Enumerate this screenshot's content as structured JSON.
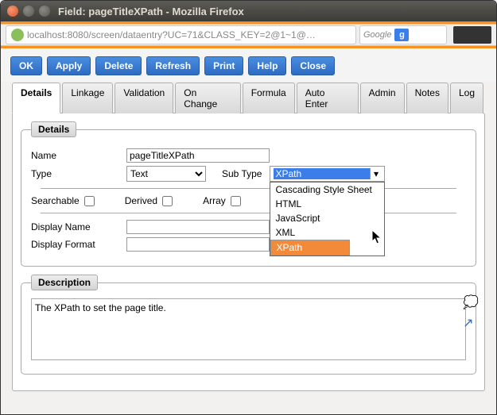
{
  "window": {
    "title": "Field: pageTitleXPath - Mozilla Firefox"
  },
  "url": "localhost:8080/screen/dataentry?UC=71&CLASS_KEY=2@1~1@…",
  "search": {
    "placeholder": "Google",
    "g": "g"
  },
  "toolbar": {
    "ok": "OK",
    "apply": "Apply",
    "delete": "Delete",
    "refresh": "Refresh",
    "print": "Print",
    "help": "Help",
    "close": "Close"
  },
  "tabs": {
    "details": "Details",
    "linkage": "Linkage",
    "validation": "Validation",
    "onchange": "On Change",
    "formula": "Formula",
    "autoenter": "Auto Enter",
    "admin": "Admin",
    "notes": "Notes",
    "log": "Log"
  },
  "fieldset": {
    "details_legend": "Details",
    "description_legend": "Description"
  },
  "labels": {
    "name": "Name",
    "type": "Type",
    "subtype": "Sub Type",
    "searchable": "Searchable",
    "derived": "Derived",
    "array": "Array",
    "display_name": "Display Name",
    "display_format": "Display Format"
  },
  "values": {
    "name": "pageTitleXPath",
    "type": "Text",
    "subtype": "XPath",
    "display_name": "",
    "display_format": "",
    "description": "The XPath to set the page title."
  },
  "subtype_options": {
    "css": "Cascading Style Sheet",
    "html": "HTML",
    "js": "JavaScript",
    "xml": "XML",
    "xpath": "XPath"
  }
}
